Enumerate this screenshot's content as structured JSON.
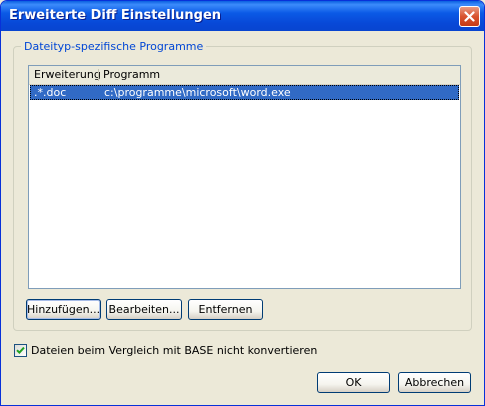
{
  "window": {
    "title": "Erweiterte Diff Einstellungen"
  },
  "group": {
    "label": "Dateityp-spezifische Programme",
    "columns": [
      "Erweiterung",
      "Programm"
    ],
    "rows": [
      {
        "extension": ".*.doc",
        "program": "c:\\programme\\microsoft\\word.exe",
        "selected": true
      }
    ],
    "buttons": {
      "add": "Hinzufügen...",
      "edit": "Bearbeiten...",
      "remove": "Entfernen"
    }
  },
  "checkbox": {
    "label": "Dateien beim Vergleich mit BASE nicht konvertieren",
    "checked": true
  },
  "footer": {
    "ok": "OK",
    "cancel": "Abbrechen"
  },
  "icons": {
    "close": "close-icon",
    "checkmark": "checkmark-icon"
  },
  "colors": {
    "titlebar": "#0845D0",
    "selection": "#316AC5",
    "group_label": "#0046D5",
    "background": "#ECE9D8"
  }
}
